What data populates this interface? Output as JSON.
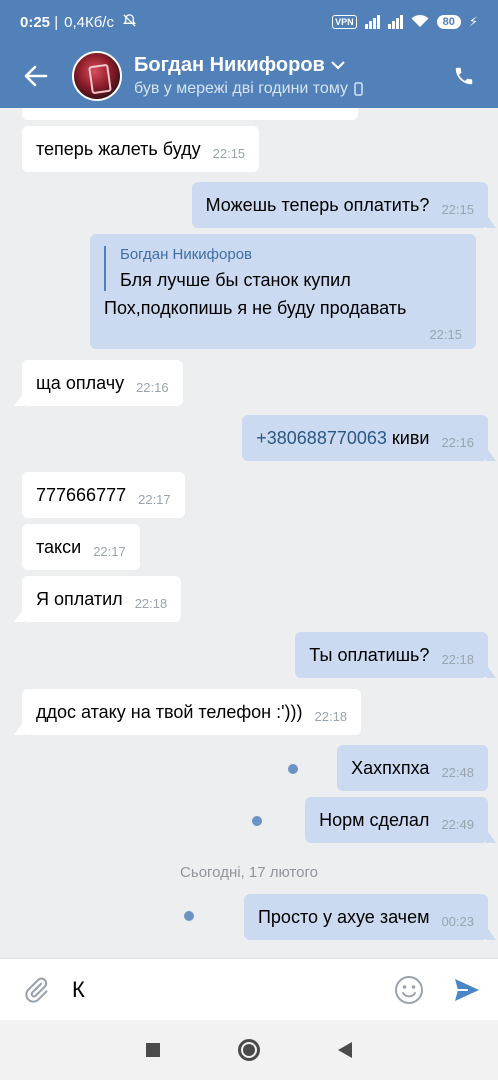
{
  "status_bar": {
    "time": "0:25",
    "network_speed": "0,4Кб/с",
    "vpn": "VPN",
    "battery": "80"
  },
  "header": {
    "name": "Богдан Никифоров",
    "last_seen": "був у мережі дві години тому"
  },
  "messages": [
    {
      "dir": "in",
      "text": "теперь жалеть буду",
      "time": "22:15"
    },
    {
      "dir": "out",
      "text": "Можешь теперь оплатить?",
      "time": "22:15"
    },
    {
      "dir": "out",
      "reply_name": "Богдан Никифоров",
      "reply_text": "Бля лучше бы станок купил",
      "text": "Пох,подкопишь я не буду продавать",
      "time": "22:15"
    },
    {
      "dir": "in",
      "text": "ща оплачу",
      "time": "22:16"
    },
    {
      "dir": "out",
      "link": "+380688770063",
      "text": " киви",
      "time": "22:16"
    },
    {
      "dir": "in",
      "text": "777666777",
      "time": "22:17"
    },
    {
      "dir": "in",
      "text": "такси",
      "time": "22:17"
    },
    {
      "dir": "in",
      "text": "Я оплатил",
      "time": "22:18"
    },
    {
      "dir": "out",
      "text": "Ты оплатишь?",
      "time": "22:18"
    },
    {
      "dir": "in",
      "text": "ддос атаку на твой телефон :')))",
      "time": "22:18"
    },
    {
      "dir": "out",
      "text": "Хахпхпха",
      "time": "22:48"
    },
    {
      "dir": "out",
      "text": "Норм сделал",
      "time": "22:49"
    },
    {
      "dir": "out",
      "text": "Просто у ахуе зачем",
      "time": "00:23"
    }
  ],
  "date_separator": "Сьогодні, 17 лютого",
  "composer": {
    "value": "К"
  },
  "colors": {
    "header": "#5181b8",
    "outgoing": "#cbdaf0",
    "incoming": "#ffffff",
    "background": "#edeef0",
    "accent": "#4a86c5"
  },
  "icons": [
    "back-arrow-icon",
    "chevron-down-icon",
    "phone-icon",
    "paperclip-icon",
    "emoji-icon",
    "send-icon",
    "mute-icon",
    "wifi-icon",
    "charging-icon"
  ]
}
